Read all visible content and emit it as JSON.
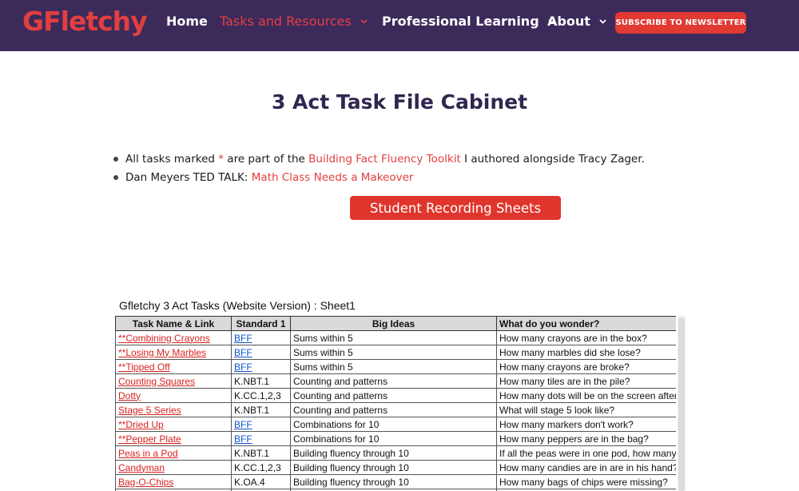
{
  "header": {
    "logo": "GFletchy",
    "nav": [
      {
        "label": "Home",
        "dropdown": false
      },
      {
        "label": "Tasks and Resources",
        "dropdown": true
      },
      {
        "label": "Professional Learning",
        "dropdown": true
      },
      {
        "label": "About",
        "dropdown": true
      }
    ],
    "subscribe_label": "SUBSCRIBE TO NEWSLETTER"
  },
  "main": {
    "title": "3 Act Task File Cabinet",
    "bullet1": {
      "prefix": "All tasks marked ",
      "star": "*",
      "middle": " are part of the ",
      "link": "Building Fact Fluency Toolkit",
      "suffix": " I authored alongside Tracy Zager."
    },
    "bullet2": {
      "prefix": "Dan Meyers TED TALK: ",
      "link": "Math Class Needs a Makeover"
    },
    "recording_button": "Student Recording Sheets"
  },
  "sheet": {
    "title": "Gfletchy 3 Act Tasks (Website Version) : Sheet1",
    "headers": [
      "Task Name & Link",
      "Standard 1",
      "Big Ideas",
      "What do you wonder?"
    ],
    "rows": [
      [
        "**Combining Crayons",
        "BFF",
        "Sums within 5",
        "How many crayons are in the box?"
      ],
      [
        "**Losing My Marbles",
        "BFF",
        "Sums within 5",
        "How many marbles did she lose?"
      ],
      [
        "**Tipped Off",
        "BFF",
        "Sums within 5",
        "How many crayons are broke?"
      ],
      [
        "Counting Squares",
        "K.NBT.1",
        "Counting and patterns",
        "How many tiles are in the pile?"
      ],
      [
        "Dotty",
        "K.CC.1,2,3",
        "Counting and patterns",
        "How many dots will be on the screen after th"
      ],
      [
        "Stage 5 Series",
        "K.NBT.1",
        "Counting and patterns",
        "What will stage 5 look like?"
      ],
      [
        "**Dried Up",
        "BFF",
        "Combinations for 10",
        "How many markers don't work?"
      ],
      [
        "**Pepper Plate",
        "BFF",
        "Combinations for 10",
        "How many peppers are in the bag?"
      ],
      [
        "Peas in a Pod",
        "K.NBT.1",
        "Building fluency through 10",
        "If all the peas were in one pod, how many p"
      ],
      [
        "Candyman",
        "K.CC.1,2,3",
        "Building fluency through 10",
        "How many candies are in are in his hand?"
      ],
      [
        "Bag-O-Chips",
        "K.OA.4",
        "Building fluency through 10",
        "How many bags of chips were missing?"
      ],
      [
        "",
        "",
        "",
        ""
      ]
    ]
  },
  "colors": {
    "header_bg": "#3c2a5b",
    "accent": "#e23f3f",
    "title": "#31264f",
    "link_blue": "#1155cc"
  }
}
